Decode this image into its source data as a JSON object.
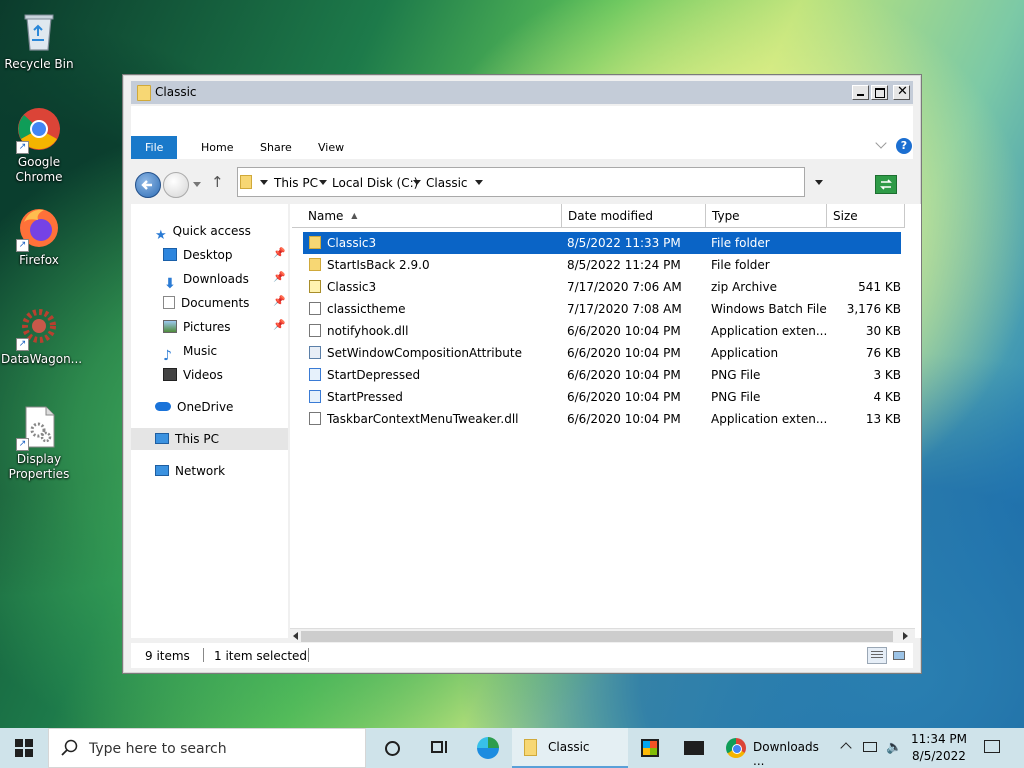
{
  "desktop": {
    "icons": [
      {
        "label_line1": "Recycle Bin",
        "label_line2": ""
      },
      {
        "label_line1": "Google",
        "label_line2": "Chrome"
      },
      {
        "label_line1": "Firefox",
        "label_line2": ""
      },
      {
        "label_line1": "DataWagon...",
        "label_line2": ""
      },
      {
        "label_line1": "Display",
        "label_line2": "Properties"
      }
    ]
  },
  "window": {
    "title": "Classic",
    "ribbon_tabs": [
      "File",
      "Home",
      "Share",
      "View"
    ],
    "address": {
      "crumbs": [
        "This PC",
        "Local Disk (C:)",
        "Classic"
      ]
    },
    "nav": {
      "quick_access": "Quick access",
      "items": [
        "Desktop",
        "Downloads",
        "Documents",
        "Pictures",
        "Music",
        "Videos"
      ],
      "onedrive": "OneDrive",
      "this_pc": "This PC",
      "network": "Network"
    },
    "columns": {
      "name": "Name",
      "date": "Date modified",
      "type": "Type",
      "size": "Size"
    },
    "files": [
      {
        "name": "Classic3",
        "date": "8/5/2022 11:33 PM",
        "type": "File folder",
        "size": "",
        "icon": "folder-icon",
        "selected": true
      },
      {
        "name": "StartIsBack 2.9.0",
        "date": "8/5/2022 11:24 PM",
        "type": "File folder",
        "size": "",
        "icon": "folder-icon"
      },
      {
        "name": "Classic3",
        "date": "7/17/2020 7:06 AM",
        "type": "zip Archive",
        "size": "541 KB",
        "icon": "zip-icon"
      },
      {
        "name": "classictheme",
        "date": "7/17/2020 7:08 AM",
        "type": "Windows Batch File",
        "size": "3,176 KB",
        "icon": "batch-file-icon"
      },
      {
        "name": "notifyhook.dll",
        "date": "6/6/2020 10:04 PM",
        "type": "Application exten...",
        "size": "30 KB",
        "icon": "dll-icon"
      },
      {
        "name": "SetWindowCompositionAttribute",
        "date": "6/6/2020 10:04 PM",
        "type": "Application",
        "size": "76 KB",
        "icon": "application-icon"
      },
      {
        "name": "StartDepressed",
        "date": "6/6/2020 10:04 PM",
        "type": "PNG File",
        "size": "3 KB",
        "icon": "png-icon"
      },
      {
        "name": "StartPressed",
        "date": "6/6/2020 10:04 PM",
        "type": "PNG File",
        "size": "4 KB",
        "icon": "png-icon"
      },
      {
        "name": "TaskbarContextMenuTweaker.dll",
        "date": "6/6/2020 10:04 PM",
        "type": "Application exten...",
        "size": "13 KB",
        "icon": "dll-icon"
      }
    ],
    "status": {
      "count": "9 items",
      "selected": "1 item selected"
    }
  },
  "taskbar": {
    "search_placeholder": "Type here to search",
    "explorer_label": "Classic",
    "chrome_label": "Downloads ...",
    "time": "11:34 PM",
    "date": "8/5/2022"
  },
  "colors": {
    "selection": "#0a64c6",
    "file_tab": "#1979ca",
    "taskbar": "#cfe3ea",
    "titlebar": "#c4ccd8"
  }
}
